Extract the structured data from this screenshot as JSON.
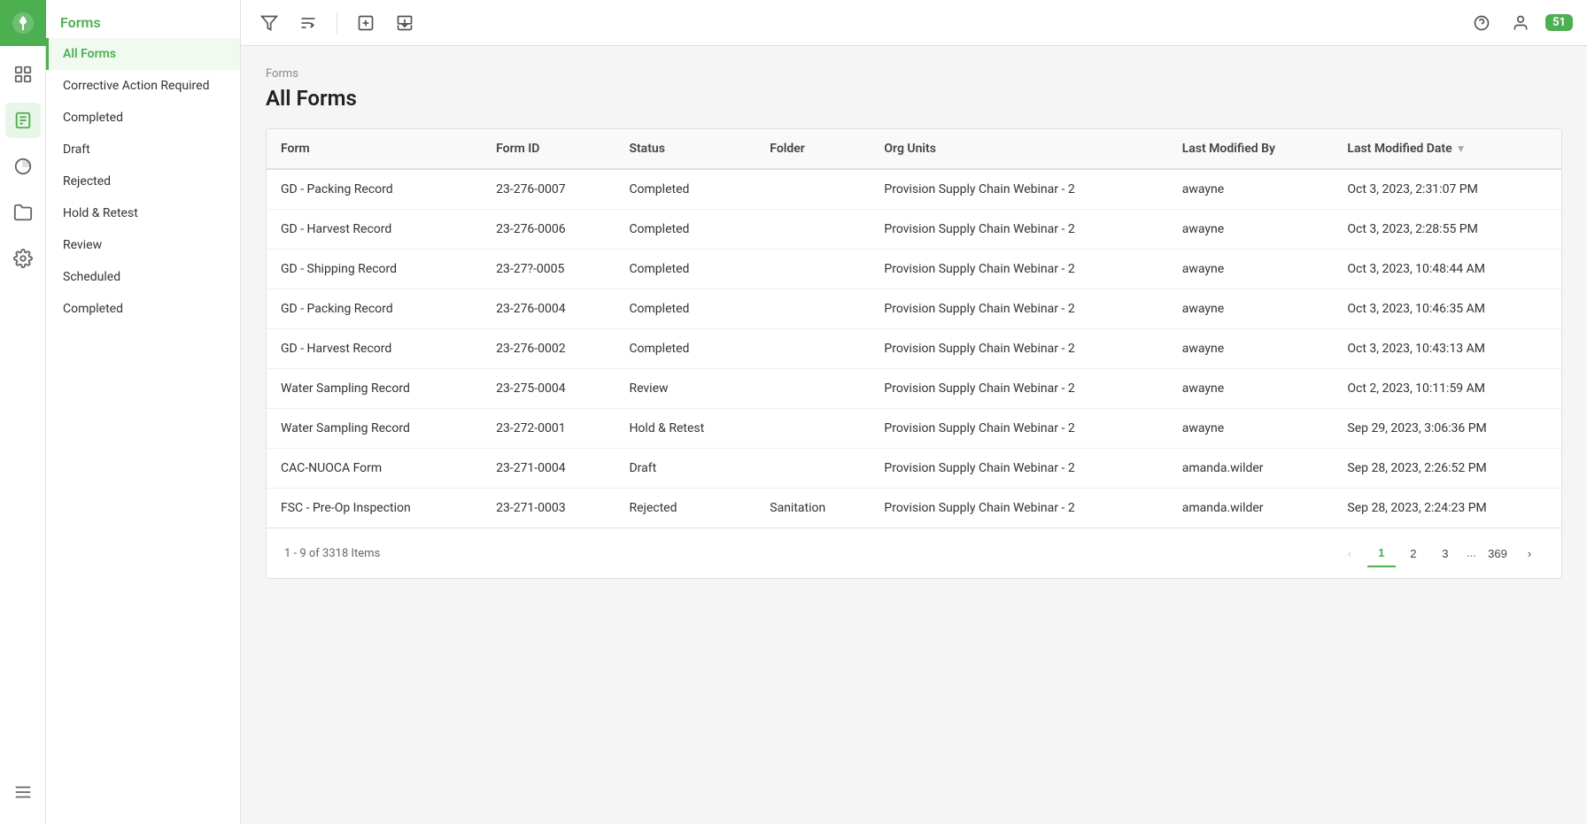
{
  "app": {
    "logo_text": "🌿",
    "title": "Forms",
    "notification_count": "51"
  },
  "topbar": {
    "filter_tooltip": "Filter",
    "sort_tooltip": "Sort",
    "add_tooltip": "Add",
    "download_tooltip": "Download",
    "help_tooltip": "Help",
    "profile_tooltip": "Profile"
  },
  "sidebar": {
    "header": "Forms",
    "items": [
      {
        "id": "all-forms",
        "label": "All Forms",
        "active": true
      },
      {
        "id": "corrective-action",
        "label": "Corrective Action Required",
        "active": false
      },
      {
        "id": "completed",
        "label": "Completed",
        "active": false
      },
      {
        "id": "draft",
        "label": "Draft",
        "active": false
      },
      {
        "id": "rejected",
        "label": "Rejected",
        "active": false
      },
      {
        "id": "hold-retest",
        "label": "Hold & Retest",
        "active": false
      },
      {
        "id": "review",
        "label": "Review",
        "active": false
      },
      {
        "id": "scheduled",
        "label": "Scheduled",
        "active": false
      },
      {
        "id": "completed2",
        "label": "Completed",
        "active": false
      }
    ]
  },
  "breadcrumb": "Forms",
  "page_title": "All Forms",
  "table": {
    "columns": [
      {
        "id": "form",
        "label": "Form",
        "sortable": false
      },
      {
        "id": "form_id",
        "label": "Form ID",
        "sortable": false
      },
      {
        "id": "status",
        "label": "Status",
        "sortable": false
      },
      {
        "id": "folder",
        "label": "Folder",
        "sortable": false
      },
      {
        "id": "org_units",
        "label": "Org Units",
        "sortable": false
      },
      {
        "id": "last_modified_by",
        "label": "Last Modified By",
        "sortable": false
      },
      {
        "id": "last_modified_date",
        "label": "Last Modified Date",
        "sortable": true
      }
    ],
    "rows": [
      {
        "form": "GD - Packing Record",
        "form_id": "23-276-0007",
        "status": "Completed",
        "folder": "",
        "org_units": "Provision Supply Chain Webinar - 2",
        "last_modified_by": "awayne",
        "last_modified_date": "Oct 3, 2023, 2:31:07 PM"
      },
      {
        "form": "GD - Harvest Record",
        "form_id": "23-276-0006",
        "status": "Completed",
        "folder": "",
        "org_units": "Provision Supply Chain Webinar - 2",
        "last_modified_by": "awayne",
        "last_modified_date": "Oct 3, 2023, 2:28:55 PM"
      },
      {
        "form": "GD - Shipping Record",
        "form_id": "23-27?-0005",
        "status": "Completed",
        "folder": "",
        "org_units": "Provision Supply Chain Webinar - 2",
        "last_modified_by": "awayne",
        "last_modified_date": "Oct 3, 2023, 10:48:44 AM"
      },
      {
        "form": "GD - Packing Record",
        "form_id": "23-276-0004",
        "status": "Completed",
        "folder": "",
        "org_units": "Provision Supply Chain Webinar - 2",
        "last_modified_by": "awayne",
        "last_modified_date": "Oct 3, 2023, 10:46:35 AM"
      },
      {
        "form": "GD - Harvest Record",
        "form_id": "23-276-0002",
        "status": "Completed",
        "folder": "",
        "org_units": "Provision Supply Chain Webinar - 2",
        "last_modified_by": "awayne",
        "last_modified_date": "Oct 3, 2023, 10:43:13 AM"
      },
      {
        "form": "Water Sampling Record",
        "form_id": "23-275-0004",
        "status": "Review",
        "folder": "",
        "org_units": "Provision Supply Chain Webinar - 2",
        "last_modified_by": "awayne",
        "last_modified_date": "Oct 2, 2023, 10:11:59 AM"
      },
      {
        "form": "Water Sampling Record",
        "form_id": "23-272-0001",
        "status": "Hold & Retest",
        "folder": "",
        "org_units": "Provision Supply Chain Webinar - 2",
        "last_modified_by": "awayne",
        "last_modified_date": "Sep 29, 2023, 3:06:36 PM"
      },
      {
        "form": "CAC-NUOCA Form",
        "form_id": "23-271-0004",
        "status": "Draft",
        "folder": "",
        "org_units": "Provision Supply Chain Webinar - 2",
        "last_modified_by": "amanda.wilder",
        "last_modified_date": "Sep 28, 2023, 2:26:52 PM"
      },
      {
        "form": "FSC - Pre-Op Inspection",
        "form_id": "23-271-0003",
        "status": "Rejected",
        "folder": "Sanitation",
        "org_units": "Provision Supply Chain Webinar - 2",
        "last_modified_by": "amanda.wilder",
        "last_modified_date": "Sep 28, 2023, 2:24:23 PM"
      }
    ]
  },
  "pagination": {
    "info": "1 - 9 of 3318 Items",
    "current_page": 1,
    "total_pages": 369,
    "pages_shown": [
      "1",
      "2",
      "3",
      "...",
      "369"
    ]
  }
}
